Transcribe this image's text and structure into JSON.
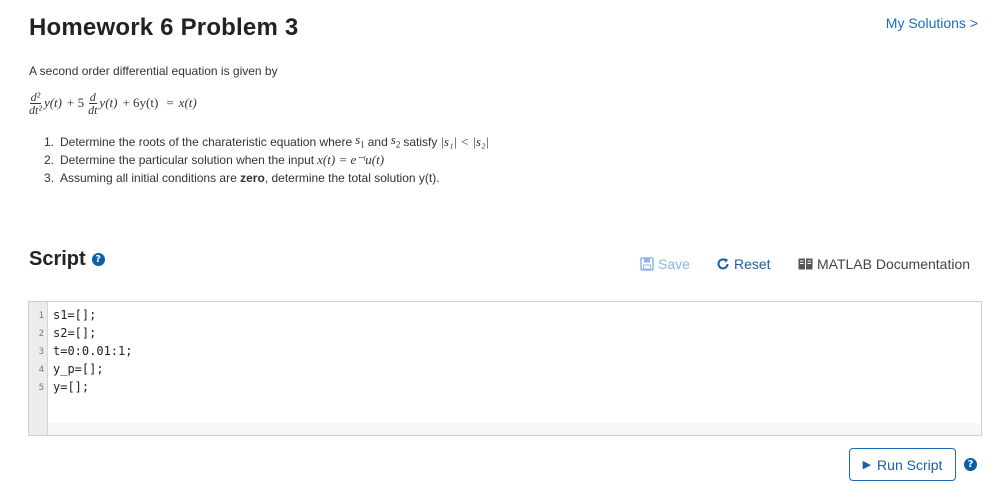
{
  "header": {
    "title": "Homework 6 Problem 3",
    "my_solutions": "My Solutions >"
  },
  "problem": {
    "intro": "A second order differential equation is given by",
    "equation": {
      "d2_num": "d²",
      "d2_den": "dt²",
      "term1": "y(t)",
      "plus1": "+ 5",
      "d_num": "d",
      "d_den": "dt",
      "term2": "y(t)",
      "plus2": "+ 6y(t)",
      "equals": "=",
      "rhs": "x(t)"
    },
    "tasks": [
      {
        "num": "1.",
        "text_a": "Determine the roots of the charateristic equation where",
        "s1": "s",
        "s1_sub": "1",
        "and": "and",
        "s2": "s",
        "s2_sub": "2",
        "satisfy": "satisfy",
        "ineq": "|s₁| < |s₂|"
      },
      {
        "num": "2.",
        "text_a": "Determine the particular solution when the input",
        "input": "x(t) = e⁻ᵗu(t)"
      },
      {
        "num": "3.",
        "text_a": "Assuming all initial conditions are",
        "bold": "zero",
        "text_b": ", determine the total solution y(t)."
      }
    ]
  },
  "script": {
    "heading": "Script",
    "help": "?",
    "save_label": "Save",
    "reset_label": "Reset",
    "doc_label": "MATLAB Documentation",
    "lines": [
      {
        "num": "1",
        "code": "s1=[];"
      },
      {
        "num": "2",
        "code": "s2=[];"
      },
      {
        "num": "3",
        "code": "t=0:0.01:1;"
      },
      {
        "num": "4",
        "code": "y_p=[];"
      },
      {
        "num": "5",
        "code": "y=[];"
      }
    ]
  },
  "footer": {
    "run_label": "Run Script",
    "help": "?"
  },
  "colors": {
    "link": "#1c6bbf",
    "help_icon": "#0b5fa5",
    "save_disabled": "#8eb7df"
  }
}
